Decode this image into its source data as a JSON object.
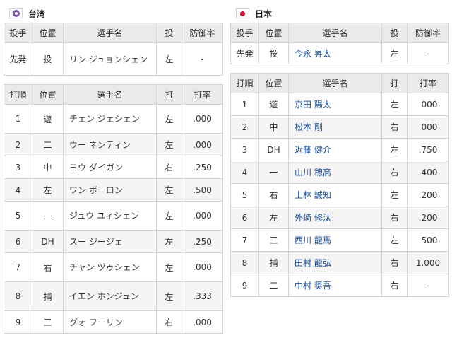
{
  "columns": {
    "pitcher": [
      "投手",
      "位置",
      "選手名",
      "投",
      "防御率"
    ],
    "batter": [
      "打順",
      "位置",
      "選手名",
      "打",
      "打率"
    ]
  },
  "left": {
    "team": "台湾",
    "flag": "chinese-taipei-flag-icon",
    "pitchers": [
      {
        "role": "先発",
        "pos": "投",
        "name": "リン ジュョンシェン",
        "hand": "左",
        "era": "-"
      }
    ],
    "batters": [
      {
        "order": "1",
        "pos": "遊",
        "name": "チェン ジェシェン",
        "hand": "左",
        "avg": ".000"
      },
      {
        "order": "2",
        "pos": "二",
        "name": "ウー ネンティン",
        "hand": "左",
        "avg": ".000"
      },
      {
        "order": "3",
        "pos": "中",
        "name": "ヨウ ダイガン",
        "hand": "右",
        "avg": ".250"
      },
      {
        "order": "4",
        "pos": "左",
        "name": "ワン ボーロン",
        "hand": "左",
        "avg": ".500"
      },
      {
        "order": "5",
        "pos": "一",
        "name": "ジュウ ユィシェン",
        "hand": "左",
        "avg": ".000"
      },
      {
        "order": "6",
        "pos": "DH",
        "name": "スー ジージェ",
        "hand": "左",
        "avg": ".250"
      },
      {
        "order": "7",
        "pos": "右",
        "name": "チャン ヅゥシェン",
        "hand": "左",
        "avg": ".000"
      },
      {
        "order": "8",
        "pos": "捕",
        "name": "イエン ホンジュン",
        "hand": "左",
        "avg": ".333"
      },
      {
        "order": "9",
        "pos": "三",
        "name": "グォ フーリン",
        "hand": "右",
        "avg": ".000"
      }
    ]
  },
  "right": {
    "team": "日本",
    "flag": "japan-flag-icon",
    "pitchers": [
      {
        "role": "先発",
        "pos": "投",
        "name": "今永 昇太",
        "hand": "左",
        "era": "-"
      }
    ],
    "batters": [
      {
        "order": "1",
        "pos": "遊",
        "name": "京田 陽太",
        "hand": "左",
        "avg": ".000"
      },
      {
        "order": "2",
        "pos": "中",
        "name": "松本 剛",
        "hand": "右",
        "avg": ".000"
      },
      {
        "order": "3",
        "pos": "DH",
        "name": "近藤 健介",
        "hand": "左",
        "avg": ".750"
      },
      {
        "order": "4",
        "pos": "一",
        "name": "山川 穂高",
        "hand": "右",
        "avg": ".400"
      },
      {
        "order": "5",
        "pos": "右",
        "name": "上林 誠知",
        "hand": "左",
        "avg": ".200"
      },
      {
        "order": "6",
        "pos": "左",
        "name": "外崎 修汰",
        "hand": "右",
        "avg": ".200"
      },
      {
        "order": "7",
        "pos": "三",
        "name": "西川 龍馬",
        "hand": "左",
        "avg": ".500"
      },
      {
        "order": "8",
        "pos": "捕",
        "name": "田村 龍弘",
        "hand": "右",
        "avg": "1.000"
      },
      {
        "order": "9",
        "pos": "二",
        "name": "中村 奨吾",
        "hand": "右",
        "avg": "-"
      }
    ]
  }
}
